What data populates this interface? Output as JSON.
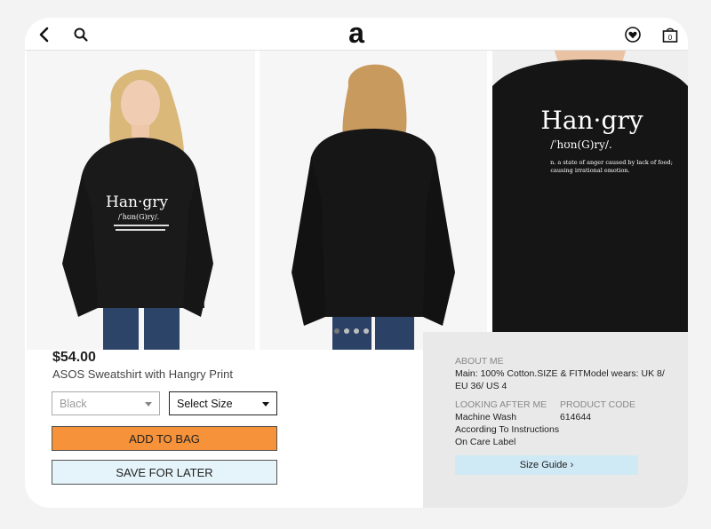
{
  "header": {
    "logo_letter": "a"
  },
  "gallery": {
    "dot_count": 4,
    "active_dot": 0,
    "printed": {
      "word": "Han·gry",
      "phonetic": "/ˈhʊn(G)ry/.",
      "definition_line1": "n. a state of anger caused by lack of food;",
      "definition_line2": "causing irrational emotion."
    }
  },
  "product": {
    "price": "$54.00",
    "name": "ASOS Sweatshirt with Hangry Print",
    "color_select": "Black",
    "size_select": "Select Size",
    "add_to_bag": "ADD TO BAG",
    "save_for_later": "SAVE FOR LATER"
  },
  "info": {
    "about_label": "ABOUT ME",
    "about_value": "Main: 100% Cotton.SIZE & FITModel wears: UK 8/ EU 36/ US 4",
    "care_label": "LOOKING AFTER ME",
    "care_value": "Machine Wash According To Instructions On Care Label",
    "code_label": "PRODUCT CODE",
    "code_value": "614644",
    "size_guide": "Size Guide ›"
  },
  "colors": {
    "accent_orange": "#f5923a",
    "light_blue": "#e5f4fa",
    "guide_blue": "#cfe9f5",
    "info_gray": "#e9e9e9"
  }
}
